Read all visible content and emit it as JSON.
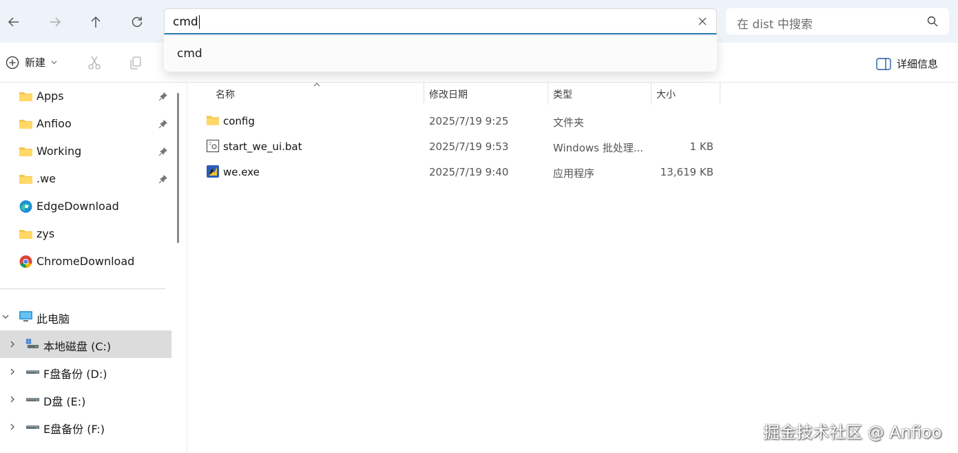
{
  "address": {
    "value": "cmd",
    "suggestion": "cmd"
  },
  "search": {
    "placeholder": "在 dist 中搜索"
  },
  "toolbar": {
    "new_label": "新建",
    "details_label": "详细信息"
  },
  "sidebar": {
    "quick_access": [
      {
        "label": "Apps",
        "icon": "folder-icon",
        "pinned": true
      },
      {
        "label": "Anfioo",
        "icon": "folder-icon",
        "pinned": true
      },
      {
        "label": "Working",
        "icon": "folder-icon",
        "pinned": true
      },
      {
        "label": ".we",
        "icon": "folder-icon",
        "pinned": true
      },
      {
        "label": "EdgeDownload",
        "icon": "edge-icon",
        "pinned": false
      },
      {
        "label": "zys",
        "icon": "folder-icon",
        "pinned": false
      },
      {
        "label": "ChromeDownload",
        "icon": "chrome-icon",
        "pinned": false
      }
    ],
    "this_pc": "此电脑",
    "drives": [
      {
        "label": "本地磁盘 (C:)",
        "selected": true
      },
      {
        "label": "F盘备份 (D:)",
        "selected": false
      },
      {
        "label": "D盘 (E:)",
        "selected": false
      },
      {
        "label": "E盘备份 (F:)",
        "selected": false
      }
    ]
  },
  "columns": {
    "name": "名称",
    "date": "修改日期",
    "type": "类型",
    "size": "大小"
  },
  "files": [
    {
      "name": "config",
      "date": "2025/7/19 9:25",
      "type": "文件夹",
      "size": "",
      "icon": "folder-icon"
    },
    {
      "name": "start_we_ui.bat",
      "date": "2025/7/19 9:53",
      "type": "Windows 批处理...",
      "size": "1 KB",
      "icon": "bat-file-icon"
    },
    {
      "name": "we.exe",
      "date": "2025/7/19 9:40",
      "type": "应用程序",
      "size": "13,619 KB",
      "icon": "exe-app-icon"
    }
  ],
  "watermark": "掘金技术社区 @ Anfioo"
}
